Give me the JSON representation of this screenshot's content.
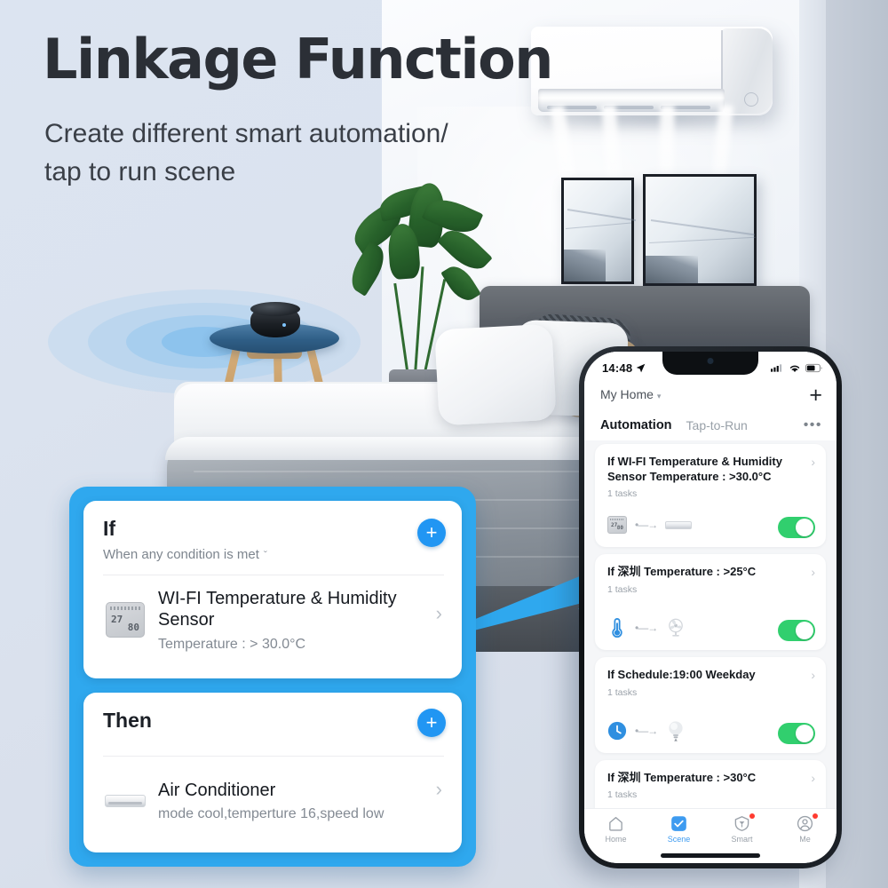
{
  "hero": {
    "title": "Linkage Function",
    "subtitle": "Create different smart automation/ tap to run scene"
  },
  "colors": {
    "accent_blue": "#2fa8ee",
    "plus_blue": "#2196f3",
    "toggle_green": "#31cf6e",
    "badge_red": "#ff3b30",
    "title_dark": "#2b2f36",
    "page_bg": "#dde4ef"
  },
  "editor_panel": {
    "if_card": {
      "title": "If",
      "subtitle": "When any condition is met",
      "caret": "ˇ",
      "add_label": "+",
      "row": {
        "icon": "temperature-humidity-sensor-icon",
        "title": "WI-FI Temperature & Humidity Sensor",
        "desc": "Temperature : > 30.0°C",
        "chevron": "›",
        "sensor_reading_top": "27",
        "sensor_reading_bottom": "80"
      }
    },
    "then_card": {
      "title": "Then",
      "add_label": "+",
      "row": {
        "icon": "air-conditioner-icon",
        "title": "Air Conditioner",
        "desc": "mode cool,temperture 16,speed low",
        "chevron": "›"
      }
    }
  },
  "phone": {
    "status_bar": {
      "time": "14:48",
      "location_icon": "location-arrow-icon",
      "signal_icon": "cellular-signal-icon",
      "wifi_icon": "wifi-icon",
      "battery_icon": "battery-icon"
    },
    "header": {
      "home_name": "My Home",
      "home_caret": "▾",
      "add_label": "+",
      "more_label": "•••"
    },
    "tabs": [
      {
        "label": "Automation",
        "active": true
      },
      {
        "label": "Tap-to-Run",
        "active": false
      }
    ],
    "automations": [
      {
        "title": "If WI-FI Temperature & Humidity Sensor Temperature : >30.0°C",
        "tasks": "1 tasks",
        "chevron": "›",
        "trigger_icon": "temperature-humidity-sensor-icon",
        "flow_arrow": "•—→",
        "action_icon": "air-conditioner-icon",
        "enabled": true,
        "sensor_reading_top": "27",
        "sensor_reading_bottom": "80"
      },
      {
        "title": "If 深圳 Temperature : >25°C",
        "tasks": "1 tasks",
        "chevron": "›",
        "trigger_icon": "thermometer-icon",
        "flow_arrow": "•—→",
        "action_icon": "fan-icon",
        "enabled": true
      },
      {
        "title": "If Schedule:19:00 Weekday",
        "tasks": "1 tasks",
        "chevron": "›",
        "trigger_icon": "clock-icon",
        "flow_arrow": "•—→",
        "action_icon": "light-bulb-icon",
        "enabled": true
      },
      {
        "title": "If 深圳 Temperature : >30°C",
        "tasks": "1 tasks",
        "chevron": "›",
        "trigger_icon": "",
        "flow_arrow": "",
        "action_icon": "",
        "enabled": false
      }
    ],
    "tabbar": [
      {
        "label": "Home",
        "icon": "home-icon",
        "active": false,
        "badge": false
      },
      {
        "label": "Scene",
        "icon": "scene-check-icon",
        "active": true,
        "badge": false
      },
      {
        "label": "Smart",
        "icon": "smart-icon",
        "active": false,
        "badge": true
      },
      {
        "label": "Me",
        "icon": "profile-icon",
        "active": false,
        "badge": true
      }
    ]
  },
  "scene": {
    "devices": [
      {
        "name": "air-conditioner-wall-unit"
      },
      {
        "name": "smart-hub-puck"
      },
      {
        "name": "wall-art-frames"
      },
      {
        "name": "bed"
      },
      {
        "name": "potted-plant"
      }
    ]
  }
}
